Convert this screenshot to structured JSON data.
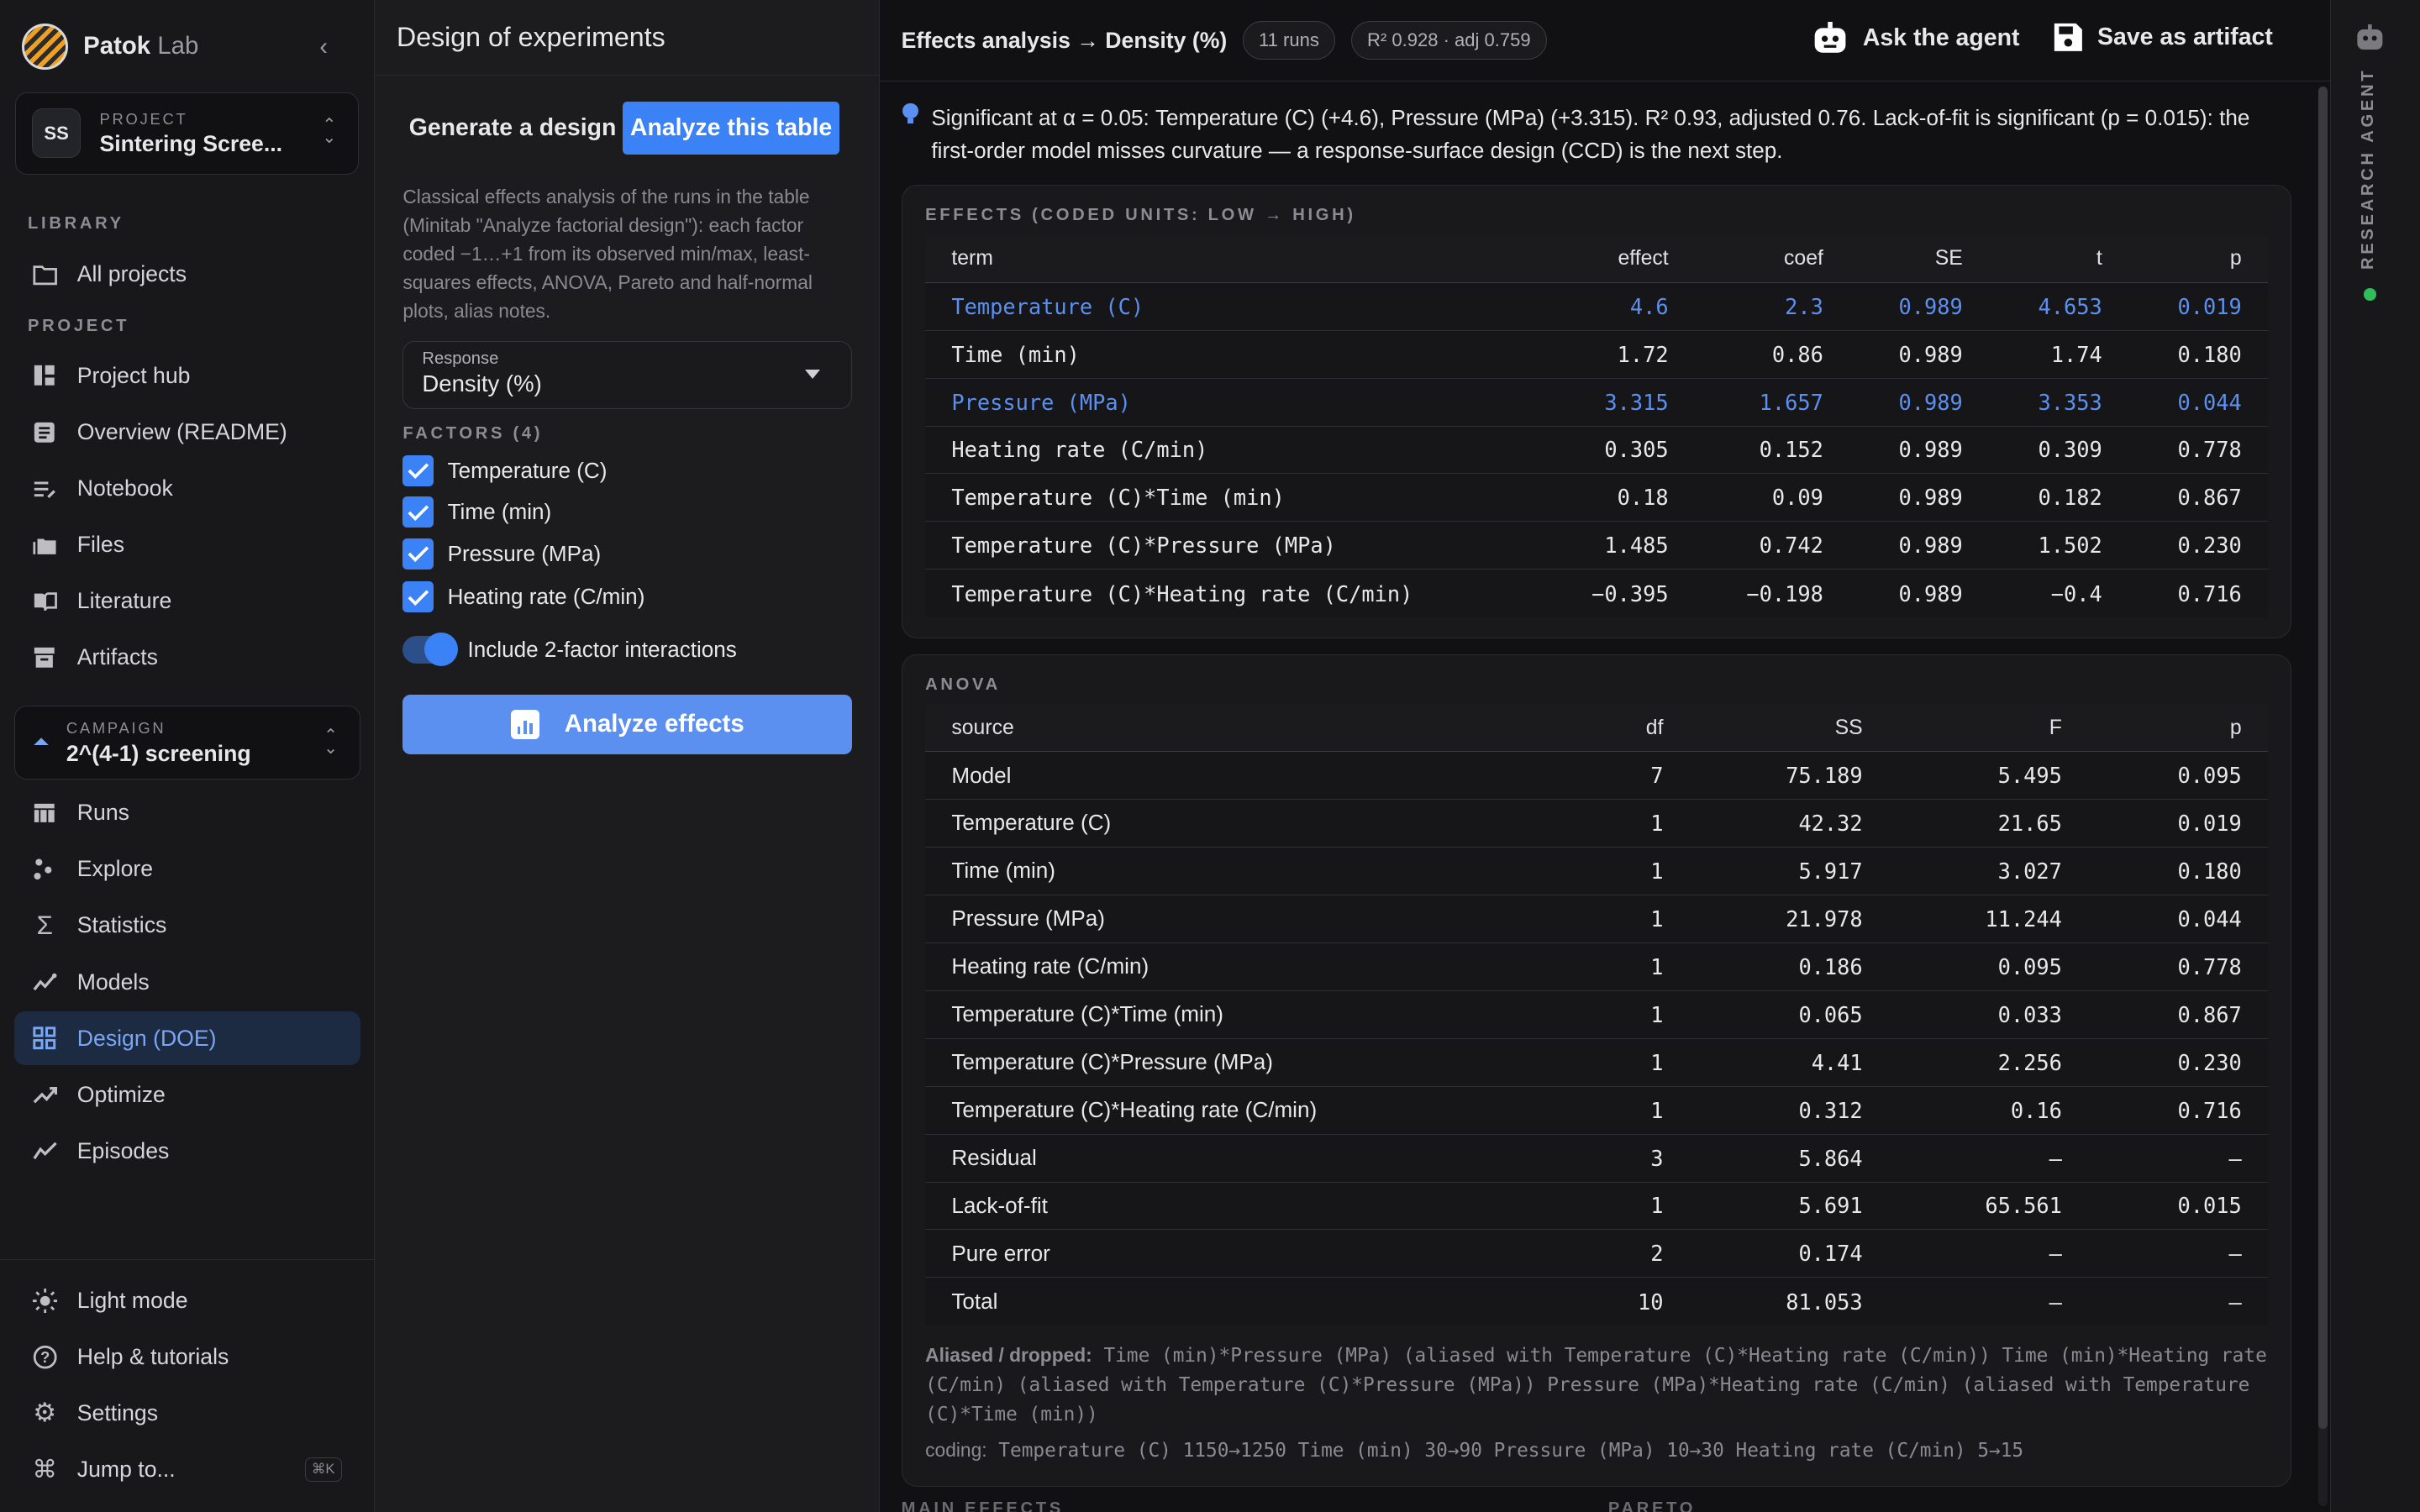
{
  "sidebar": {
    "brand": "Patok",
    "brand_suffix": "Lab",
    "project_label": "PROJECT",
    "project_avatar": "SS",
    "project_name": "Sintering Scree...",
    "library_label": "LIBRARY",
    "all_projects": "All projects",
    "project_section_label": "PROJECT",
    "project_items": [
      "Project hub",
      "Overview (README)",
      "Notebook",
      "Files",
      "Literature",
      "Artifacts"
    ],
    "campaign_label": "CAMPAIGN",
    "campaign_name": "2^(4-1) screening",
    "campaign_items": [
      "Runs",
      "Explore",
      "Statistics",
      "Models",
      "Design (DOE)",
      "Optimize",
      "Episodes"
    ],
    "active_item": "Design (DOE)",
    "bottom_items": [
      "Light mode",
      "Help & tutorials",
      "Settings",
      "Jump to..."
    ],
    "jump_shortcut": "⌘K"
  },
  "doe": {
    "title": "Design of experiments",
    "tab_generate": "Generate a design",
    "tab_analyze": "Analyze this table",
    "description": "Classical effects analysis of the runs in the table (Minitab \"Analyze factorial design\"): each factor coded −1…+1 from its observed min/max, least-squares effects, ANOVA, Pareto and half-normal plots, alias notes.",
    "response_label": "Response",
    "response_value": "Density (%)",
    "factors_label": "FACTORS (4)",
    "factors": [
      "Temperature (C)",
      "Time (min)",
      "Pressure (MPa)",
      "Heating rate (C/min)"
    ],
    "interactions_label": "Include 2-factor interactions",
    "analyze_button": "Analyze effects"
  },
  "main": {
    "title": "Effects analysis → Density (%)",
    "runs_pill": "11 runs",
    "r2_pill": "R² 0.928 · adj 0.759",
    "ask_agent": "Ask the agent",
    "save_artifact": "Save as artifact",
    "insight": "Significant at α = 0.05: Temperature (C) (+4.6), Pressure (MPa) (+3.315). R² 0.93, adjusted 0.76. Lack-of-fit is significant (p = 0.015): the first-order model misses curvature — a response-surface design (CCD) is the next step.",
    "effects": {
      "title": "EFFECTS (CODED UNITS: LOW → HIGH)",
      "headers": [
        "term",
        "effect",
        "coef",
        "SE",
        "t",
        "p"
      ],
      "rows": [
        {
          "term": "Temperature (C)",
          "effect": "4.6",
          "coef": "2.3",
          "se": "0.989",
          "t": "4.653",
          "p": "0.019",
          "sig": true
        },
        {
          "term": "Time (min)",
          "effect": "1.72",
          "coef": "0.86",
          "se": "0.989",
          "t": "1.74",
          "p": "0.180",
          "sig": false
        },
        {
          "term": "Pressure (MPa)",
          "effect": "3.315",
          "coef": "1.657",
          "se": "0.989",
          "t": "3.353",
          "p": "0.044",
          "sig": true
        },
        {
          "term": "Heating rate (C/min)",
          "effect": "0.305",
          "coef": "0.152",
          "se": "0.989",
          "t": "0.309",
          "p": "0.778",
          "sig": false
        },
        {
          "term": "Temperature (C)*Time (min)",
          "effect": "0.18",
          "coef": "0.09",
          "se": "0.989",
          "t": "0.182",
          "p": "0.867",
          "sig": false
        },
        {
          "term": "Temperature (C)*Pressure (MPa)",
          "effect": "1.485",
          "coef": "0.742",
          "se": "0.989",
          "t": "1.502",
          "p": "0.230",
          "sig": false
        },
        {
          "term": "Temperature (C)*Heating rate (C/min)",
          "effect": "−0.395",
          "coef": "−0.198",
          "se": "0.989",
          "t": "−0.4",
          "p": "0.716",
          "sig": false
        }
      ]
    },
    "anova": {
      "title": "ANOVA",
      "headers": [
        "source",
        "df",
        "SS",
        "F",
        "p"
      ],
      "rows": [
        {
          "source": "Model",
          "df": "7",
          "ss": "75.189",
          "f": "5.495",
          "p": "0.095"
        },
        {
          "source": "Temperature (C)",
          "df": "1",
          "ss": "42.32",
          "f": "21.65",
          "p": "0.019"
        },
        {
          "source": "Time (min)",
          "df": "1",
          "ss": "5.917",
          "f": "3.027",
          "p": "0.180"
        },
        {
          "source": "Pressure (MPa)",
          "df": "1",
          "ss": "21.978",
          "f": "11.244",
          "p": "0.044"
        },
        {
          "source": "Heating rate (C/min)",
          "df": "1",
          "ss": "0.186",
          "f": "0.095",
          "p": "0.778"
        },
        {
          "source": "Temperature (C)*Time (min)",
          "df": "1",
          "ss": "0.065",
          "f": "0.033",
          "p": "0.867"
        },
        {
          "source": "Temperature (C)*Pressure (MPa)",
          "df": "1",
          "ss": "4.41",
          "f": "2.256",
          "p": "0.230"
        },
        {
          "source": "Temperature (C)*Heating rate (C/min)",
          "df": "1",
          "ss": "0.312",
          "f": "0.16",
          "p": "0.716"
        },
        {
          "source": "Residual",
          "df": "3",
          "ss": "5.864",
          "f": "–",
          "p": "–"
        },
        {
          "source": "Lack-of-fit",
          "df": "1",
          "ss": "5.691",
          "f": "65.561",
          "p": "0.015"
        },
        {
          "source": "Pure error",
          "df": "2",
          "ss": "0.174",
          "f": "–",
          "p": "–"
        },
        {
          "source": "Total",
          "df": "10",
          "ss": "81.053",
          "f": "–",
          "p": "–"
        }
      ],
      "aliased_label": "Aliased / dropped:",
      "aliased_text": "Time (min)*Pressure (MPa) (aliased with Temperature (C)*Heating rate (C/min)) Time (min)*Heating rate (C/min) (aliased with Temperature (C)*Pressure (MPa)) Pressure (MPa)*Heating rate (C/min) (aliased with Temperature (C)*Time (min))",
      "coding_label": "coding:",
      "coding_text": "Temperature (C) 1150→1250 Time (min) 30→90 Pressure (MPa) 10→30 Heating rate (C/min) 5→15"
    },
    "next_sections": [
      "MAIN EFFECTS",
      "PARETO"
    ]
  },
  "rail": {
    "label": "RESEARCH AGENT",
    "status_color": "#2fbf5a"
  },
  "colors": {
    "accent": "#3b82f6",
    "significant": "#5b8ff0",
    "active_nav_bg": "#1c2a42"
  }
}
